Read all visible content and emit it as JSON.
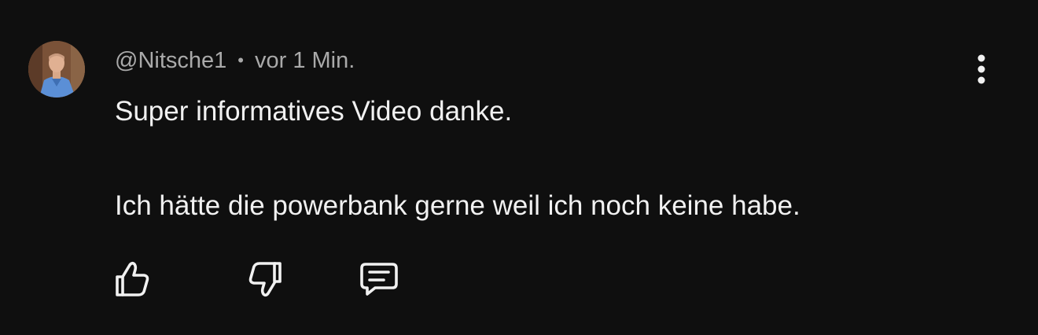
{
  "comment": {
    "author": "@Nitsche1",
    "separator": "•",
    "timestamp": "vor 1 Min.",
    "paragraphs": [
      "Super informatives Video danke.",
      "Ich hätte die powerbank gerne weil ich noch keine habe."
    ]
  },
  "icons": {
    "more": "more-vertical-icon",
    "like": "thumbs-up-icon",
    "dislike": "thumbs-down-icon",
    "reply": "reply-comment-icon"
  },
  "colors": {
    "background": "#0f0f0f",
    "text_primary": "#f1f1f1",
    "text_secondary": "#aaaaaa"
  }
}
